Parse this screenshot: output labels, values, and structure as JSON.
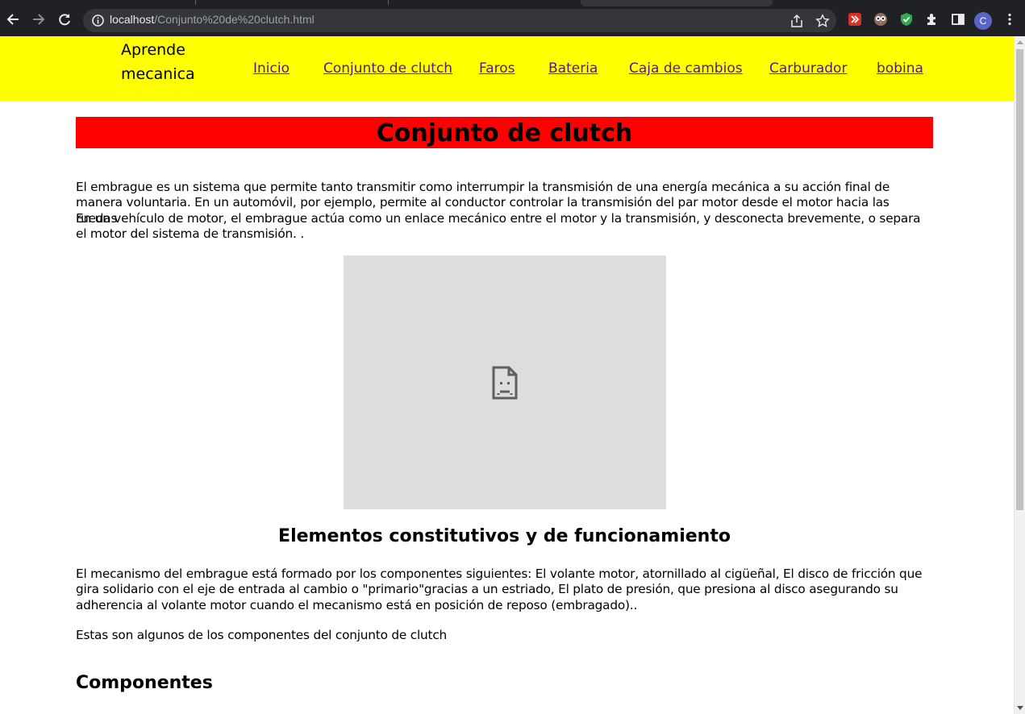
{
  "browser": {
    "url_host": "localhost",
    "url_path": "/Conjunto%20de%20clutch.html",
    "profile_initial": "C",
    "colors": {
      "frame": "#202124",
      "omnibox": "#35363a"
    }
  },
  "site": {
    "brand": "Aprende mecanica",
    "nav": [
      "Inicio",
      "Conjunto de clutch",
      "Faros",
      "Bateria",
      "Caja de cambios",
      "Carburador",
      "bobina"
    ],
    "colors": {
      "header_bg": "#ffff00",
      "title_bg": "#ff0000",
      "link": "#551a8b"
    }
  },
  "page": {
    "title": "Conjunto de clutch",
    "intro_1": "El embrague es un sistema que permite tanto transmitir como interrumpir la transmisión de una energía mecánica a su acción final de manera voluntaria. En un automóvil, por ejemplo, permite al conductor controlar la transmisión del par motor desde el motor hacia las ruedas",
    "intro_2": "En un vehículo de motor, el embrague actúa como un enlace mecánico entre el motor y la transmisión, y desconecta brevemente, o separa el motor del sistema de transmisión. .",
    "image_icon": "broken-image-icon",
    "section_heading": "Elementos constitutivos y de funcionamiento",
    "section_text": "El mecanismo del embrague está formado por los componentes siguientes: El volante motor, atornillado al cigüeñal, El disco de fricción que gira solidario con el eje de entrada al cambio o \"primario\"gracias a un estriado, El plato de presión, que presiona al disco asegurando su adherencia al volante motor cuando el mecanismo está en posición de reposo (embragado)..",
    "components_intro": "Estas son algunos de los componentes del conjunto de clutch",
    "components_heading": "Componentes"
  }
}
